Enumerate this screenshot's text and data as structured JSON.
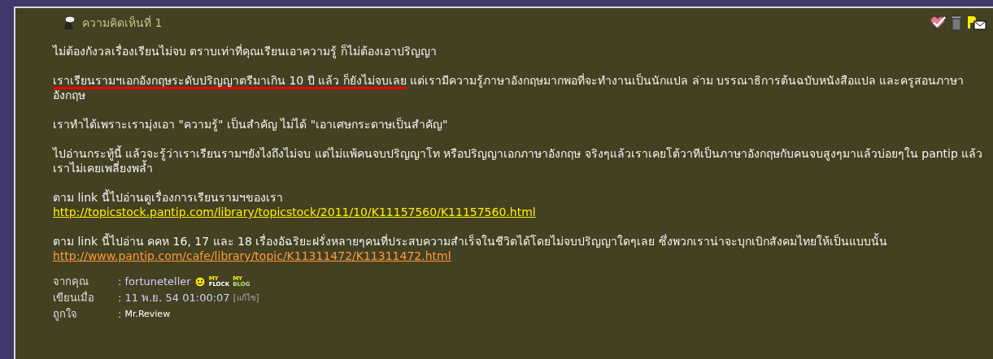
{
  "comment_title": "ความคิดเห็นที่ 1",
  "paragraphs": [
    {
      "kind": "text",
      "text": "ไม่ต้องกังวลเรื่องเรียนไม่จบ ตราบเท่าที่คุณเรียนเอาความรู้ ก็ไม่ต้องเอาปริญญา"
    },
    {
      "kind": "text",
      "underlined": "เราเรียนรามฯเอกอังกฤษระดับปริญญาตรีมาเกิน 10 ปี แล้ว ก็ยังไม่จบเลย",
      "text": " แต่เรามีความรู้ภาษาอังกฤษมากพอที่จะทำงานเป็นนักแปล ล่าม บรรณาธิการต้นฉบับหนังสือแปล และครูสอนภาษาอังกฤษ"
    },
    {
      "kind": "text",
      "text": "เราทำได้เพราะเรามุ่งเอา \"ความรู้\" เป็นสำคัญ ไม่ได้ \"เอาเศษกระดาษเป็นสำคัญ\""
    },
    {
      "kind": "text",
      "text": "ไปอ่านกระทู้นี้ แล้วจะรู้ว่าเราเรียนรามฯยังไงถึงไม่จบ แต่ไม่แพ้คนจบปริญญาโท หรือปริญญาเอกภาษาอังกฤษ จริงๆแล้วเราเคยโต้วาทีเป็นภาษาอังกฤษกับคนจบสูงๆมาแล้วบ่อยๆใน pantip แล้วเราไม่เคยเพลี่ยงพล้ำ"
    },
    {
      "kind": "link",
      "text": "ตาม link นี้ไปอ่านดูเรื่องการเรียนรามฯของเรา",
      "url": "http://topicstock.pantip.com/library/topicstock/2011/10/K11157560/K11157560.html",
      "visited": false
    },
    {
      "kind": "link",
      "text": "ตาม link นี้ไปอ่าน คคห 16, 17 และ 18 เรื่องอัฉริยะฝรั่งหลายๆคนที่ประสบความสำเร็จในชีวิตได้โดยไม่จบปริญญาใดๆเลย ซึ่งพวกเราน่าจะบุกเบิกสังคมไทยให้เป็นแบบนั้น",
      "url": "http://www.pantip.com/cafe/library/topic/K11311472/K11311472.html",
      "visited": true
    }
  ],
  "meta": {
    "from_label": "จากคุณ",
    "from_value": ": fortuneteller",
    "flock_my": "MY",
    "flock": "FLOCK",
    "blog_my": "MY",
    "blog": "BLOG",
    "date_label": "เขียนเมื่อ",
    "date_value": ": 11 พ.ย. 54 01:00:07",
    "edit": "[แก้ไข]",
    "like_label": "ถูกใจ",
    "like_colon": ":",
    "like_value": "Mr.Review"
  }
}
